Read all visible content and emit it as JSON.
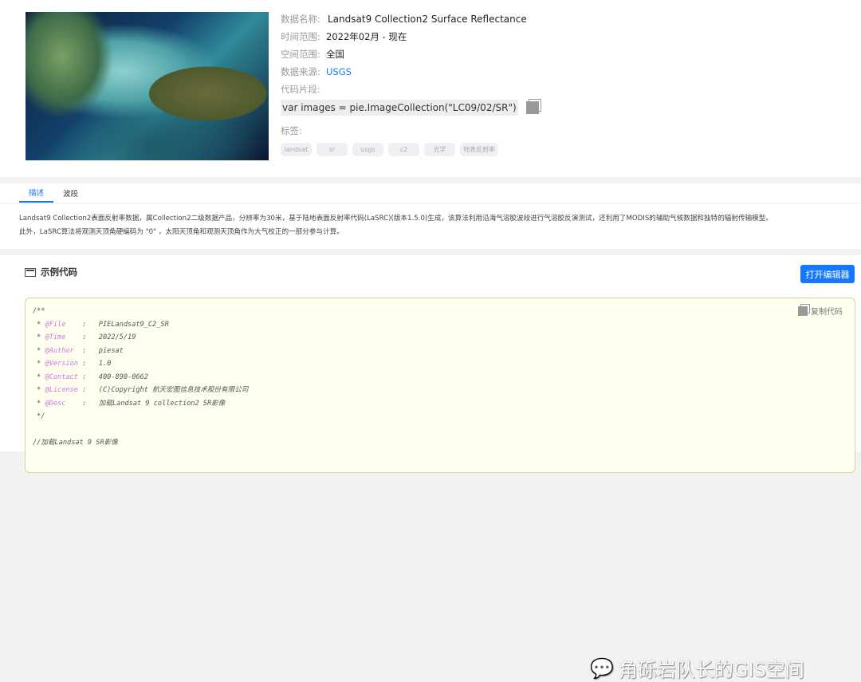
{
  "info": {
    "name_label": "数据名称:",
    "name": "Landsat9 Collection2 Surface Reflectance",
    "time_label": "时间范围:",
    "time": "2022年02月 - 现在",
    "space_label": "空间范围:",
    "space": "全国",
    "source_label": "数据来源:",
    "source": "USGS",
    "snippet_label": "代码片段:",
    "snippet": "var images = pie.ImageCollection(\"LC09/02/SR\")",
    "tags_label": "标签:",
    "tags": [
      "landsat",
      "sr",
      "usgs",
      "c2",
      "光学",
      "地表反射率"
    ]
  },
  "tabs": [
    "描述",
    "波段"
  ],
  "description": [
    "Landsat9 Collection2表面反射率数据，属Collection2二级数据产品，分辨率为30米，基于陆地表面反射率代码(LaSRC)(版本1.5.0)生成，该算法利用沿海气溶胶波段进行气溶胶反演测试，还利用了MODIS的辅助气候数据和独特的辐射传输模型。",
    "此外，LaSRC算法将观测天顶角硬编码为 \"0\" ，太阳天顶角和观测天顶角作为大气校正的一部分参与计算。"
  ],
  "example": {
    "title": "示例代码",
    "open_editor": "打开编辑器",
    "copy_code": "复制代码",
    "lines": [
      {
        "pre": "/**",
        "kw": "",
        "post": ""
      },
      {
        "pre": " * ",
        "kw": "@File",
        "post": "    :   PIELandsat9_C2_SR"
      },
      {
        "pre": " * ",
        "kw": "@Time",
        "post": "    :   2022/5/19"
      },
      {
        "pre": " * ",
        "kw": "@Author",
        "post": "  :   piesat"
      },
      {
        "pre": " * ",
        "kw": "@Version",
        "post": " :   1.0"
      },
      {
        "pre": " * ",
        "kw": "@Contact",
        "post": " :   400-890-0662"
      },
      {
        "pre": " * ",
        "kw": "@License",
        "post": " :   (C)Copyright 航天宏图信息技术股份有限公司"
      },
      {
        "pre": " * ",
        "kw": "@Desc",
        "post": "    :   加载Landsat 9 collection2 SR影像"
      },
      {
        "pre": " */",
        "kw": "",
        "post": ""
      },
      {
        "pre": "",
        "kw": "",
        "post": ""
      },
      {
        "pre": "//加载Landsat 9 SR影像",
        "kw": "",
        "post": ""
      }
    ]
  },
  "watermark": "角砾岩队长的GIS空间"
}
